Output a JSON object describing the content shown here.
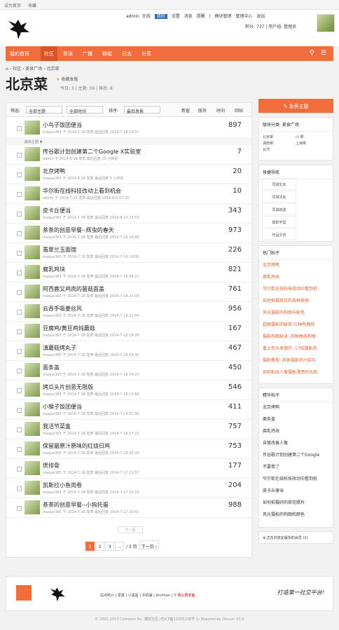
{
  "topbar": {
    "set_home": "设为首页",
    "favorite": "收藏"
  },
  "user": {
    "name": "admin",
    "online": "在线",
    "items": [
      "我的",
      "设置",
      "消息",
      "提醒",
      "|",
      "模块管理",
      "管理中心",
      "退出"
    ],
    "credits": "积分: 737",
    "group": "用户组: 管理员"
  },
  "nav": {
    "items": [
      "我的首页",
      "社区",
      "导读",
      "广播",
      "群组",
      "日志",
      "分享"
    ]
  },
  "breadcrumb": [
    "社区",
    "美食广场",
    "北京菜"
  ],
  "forum": {
    "title": "北京菜",
    "fav": "收藏本版",
    "stats": "今日: 3  |  主题: 56  |  排名: 8"
  },
  "filter": {
    "label": "筛选:",
    "sel1": "全部主题",
    "sel2": "全部时间",
    "sort": "排序:",
    "sel3": "最后发表",
    "cols": [
      "新窗",
      "版块",
      "时间",
      "回帖"
    ]
  },
  "threads": [
    {
      "title": "小鸟子饭团便当",
      "meta": "maque365  于 2014-7-18 发表  最后回复 2014-7-18 16:57",
      "count": "897"
    },
    {
      "title": "传谷歌计划创建第二个Google X实验室",
      "meta": "admin  于 2014-8-19 发表  最后回复 25 分钟前",
      "count": "7"
    },
    {
      "title": "北京烤鸭",
      "meta": "maque365  于 2014-8-18 发表  最后回复 3 小时前",
      "count": "20"
    },
    {
      "title": "华尔街在线科技改动上看到机会",
      "meta": "admin  于 2014-7-25 发表  最后回复 2014-8-6 07:24",
      "count": "10"
    },
    {
      "title": "皮卡丘便当",
      "meta": "maque365  于 2014-7-18 发表  最后回复 2014-8-10 23:53",
      "count": "343"
    },
    {
      "title": "茶茶的创意早餐--辉虫的春天",
      "meta": "maque365  于 2014-7-18 发表  最后回复 2014-7-18 18:08",
      "count": "973"
    },
    {
      "title": "翡翠兰玉面馆",
      "meta": "maque365  于 2014-7-18 发表  最后回复 2014-7-18 18:06",
      "count": "226"
    },
    {
      "title": "腐乳鸡块",
      "meta": "maque365  于 2014-7-18 发表  最后回复 2014-7-18 08:27",
      "count": "821"
    },
    {
      "title": "阿西鹿又鸡肉的菌菇面盖",
      "meta": "maque365  于 2014-7-18 发表  最后回复 2014-7-18 23:09",
      "count": "761"
    },
    {
      "title": "云吞手吸姜丝风",
      "meta": "maque365  于 2014-7-18 发表  最后回复 2014-7-18 22:54",
      "count": "956"
    },
    {
      "title": "豆腐鸡/黄豆鸡炖蘑菇",
      "meta": "maque365  于 2014-7-18 发表  最后回复 2014-7-18 18:26",
      "count": "167"
    },
    {
      "title": "滇蘑菇烤丸子",
      "meta": "maque365  于 2014-7-18 发表  最后回复 2014-7-18 14:31",
      "count": "467"
    },
    {
      "title": "面条盖",
      "meta": "maque365  于 2014-7-18 发表  最后回复 2014-7-18 14:23",
      "count": "450"
    },
    {
      "title": "烤瓜头片创意无限版",
      "meta": "maque365  于 2014-7-18 发表  最后回复 2014-7-18 13:56",
      "count": "546"
    },
    {
      "title": "小猴子饭团便当",
      "meta": "maque365  于 2014-7-18 发表  最后回复 2014-7-18 07:38",
      "count": "411"
    },
    {
      "title": "我活节菜盒",
      "meta": "maque365  于 2014-7-18 发表  最后回复 2014-7-18 07:22",
      "count": "757"
    },
    {
      "title": "保留最原汁原味的红烧日鸡",
      "meta": "maque365  于 2014-7-18 发表  最后回复 2014-7-18 04:29",
      "count": "753"
    },
    {
      "title": "煲排骨",
      "meta": "maque365  于 2014-7-18 发表  最后回复 2014-7-17 22:57",
      "count": "177"
    },
    {
      "title": "凯斯拉小鱼肉卷",
      "meta": "maque365  于 2014-7-18 发表  最后回复 2014-7-17 22:23",
      "count": "204"
    },
    {
      "title": "茶茶的创意早餐--小狗托蛋",
      "meta": "maque365  于 2014-7-18 发表  最后回复 2014-7-17 20:41",
      "count": "988"
    }
  ],
  "separator": "版块主题 ▼",
  "more": "下一页",
  "pager": [
    "1",
    "2",
    "3",
    "..",
    "/ 3 页",
    "下一页 ›"
  ],
  "sidebar": {
    "post_button": "发表主题",
    "info_title": "版块分类: 美食广场",
    "info_items": [
      "北京菜",
      "川 菜",
      "湖南菜",
      "上海菜",
      "台湾"
    ],
    "quick_title": "快捷导航",
    "quick_items": [
      "同城交友",
      "同城活动",
      "同城跳蚤",
      "摄影学堂",
      "作品交流",
      "网站",
      "山水",
      "人文",
      "动物",
      "植物"
    ],
    "hot_title": "热门帖子",
    "hot_items": [
      "北京烤鸭",
      "腐乳鸡块",
      "华尔街在线科技改动中看到机",
      "如何拍摄荷花的各种美丽",
      "风光摄影的构图与配色",
      "超图摄影的秘密!三种构图技",
      "摄影构图秘诀: 四种曲线构图",
      "重上你头发铺开: 17招摄影风",
      "摄影教程: 风景摄影的六招与",
      "如何拍出人像摄影漂亮的光线"
    ],
    "best_title": "精华帖子",
    "best_items": [
      "北京烤鸭",
      "面条盖",
      "腐乳鸡块",
      "自营改善人像",
      "传谷歌计划创建第二个Google",
      "不要慌了",
      "华尔街在线科技改动中看到机",
      "皮卡丘便当",
      "如何拍摄好的荷花照片",
      "风光摄影的构图和颜色"
    ],
    "online": "正在浏览此版块的会员 (1)"
  },
  "footer": {
    "links": "站点统计 | 举报 | 小黑屋 | 手机版 | Archiver |",
    "police": "皖公网安备",
    "slogan": "打造第一社交平台!",
    "copyright": "© 2001-2013 Comsenz Inc. 糖域社区 (粤ICP备12005218号-1) Powered by Discuz! X3.2"
  },
  "colors": {
    "accent": "#f26d3d",
    "hot_text": "#e2622f"
  }
}
